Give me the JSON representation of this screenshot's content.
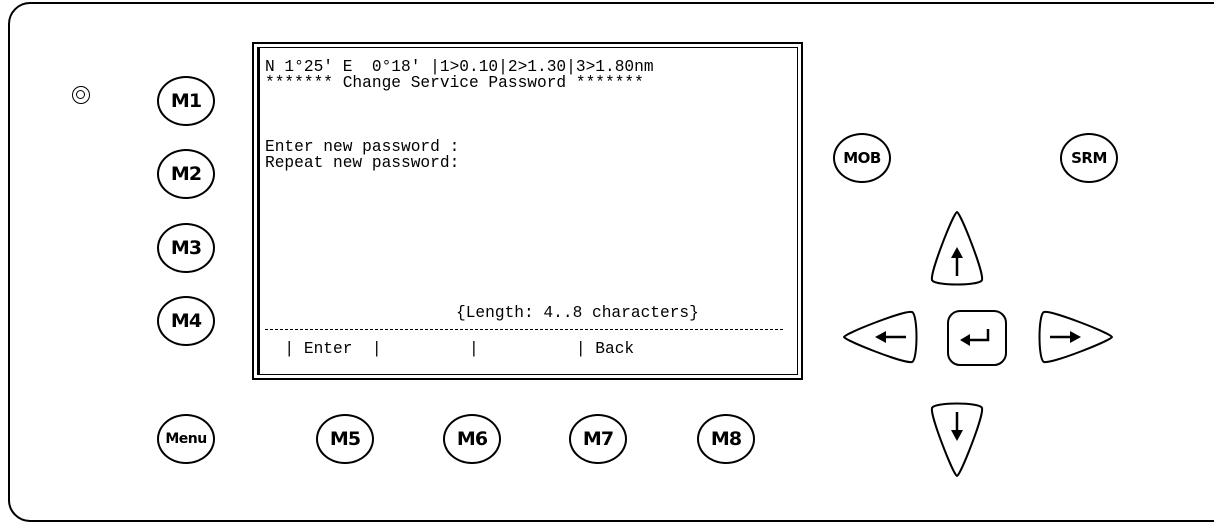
{
  "screen": {
    "status_line": "N 1°25' E  0°18' |1>0.10|2>1.30|3>1.80nm",
    "title_line": "******* Change Service Password *******",
    "field_new": "Enter new password :",
    "field_repeat": "Repeat new password:",
    "hint": "{Length: 4..8 characters}",
    "softkeys": "  | Enter  |         |          | Back"
  },
  "buttons": {
    "m1": "M1",
    "m2": "M2",
    "m3": "M3",
    "m4": "M4",
    "menu": "Menu",
    "m5": "M5",
    "m6": "M6",
    "m7": "M7",
    "m8": "M8",
    "mob": "MOB",
    "srm": "SRM"
  },
  "icons": {
    "led": "status-led-icon",
    "up": "arrow-up-icon",
    "down": "arrow-down-icon",
    "left": "arrow-left-icon",
    "right": "arrow-right-icon",
    "enter": "enter-return-icon"
  }
}
